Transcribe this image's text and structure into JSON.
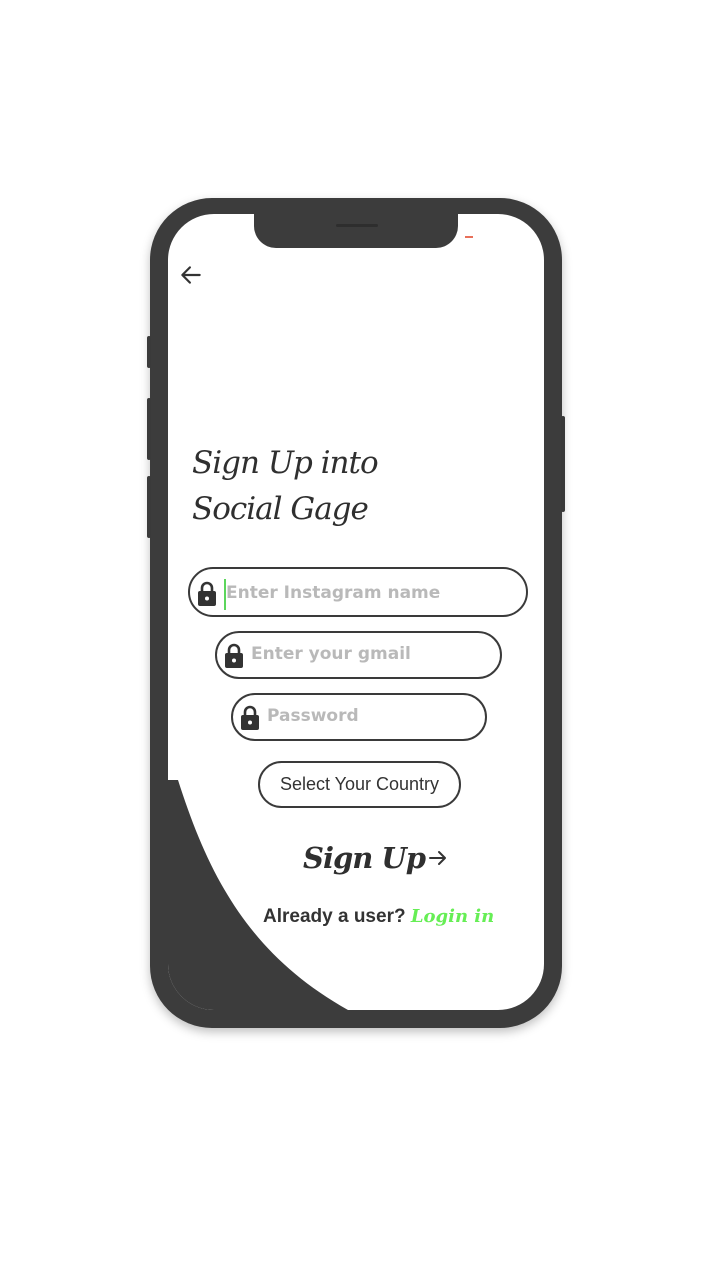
{
  "screen": {
    "title_lines": [
      "Sign Up into",
      "Social Gage"
    ]
  },
  "form": {
    "instagram_placeholder": "Enter Instagram name",
    "gmail_placeholder": "Enter your gmail",
    "password_placeholder": "Password",
    "country_button_label": "Select Your Country",
    "signup_label": "Sign Up"
  },
  "footer": {
    "prompt": "Already a user?",
    "login_label": "Login in"
  },
  "icons": {
    "back": "arrow-left-icon",
    "lock": "lock-icon",
    "signup_arrow": "arrow-right-icon"
  },
  "colors": {
    "accent": "#66ee55",
    "dark": "#3c3c3c",
    "text": "#333333",
    "placeholder": "#b9b9b9"
  }
}
